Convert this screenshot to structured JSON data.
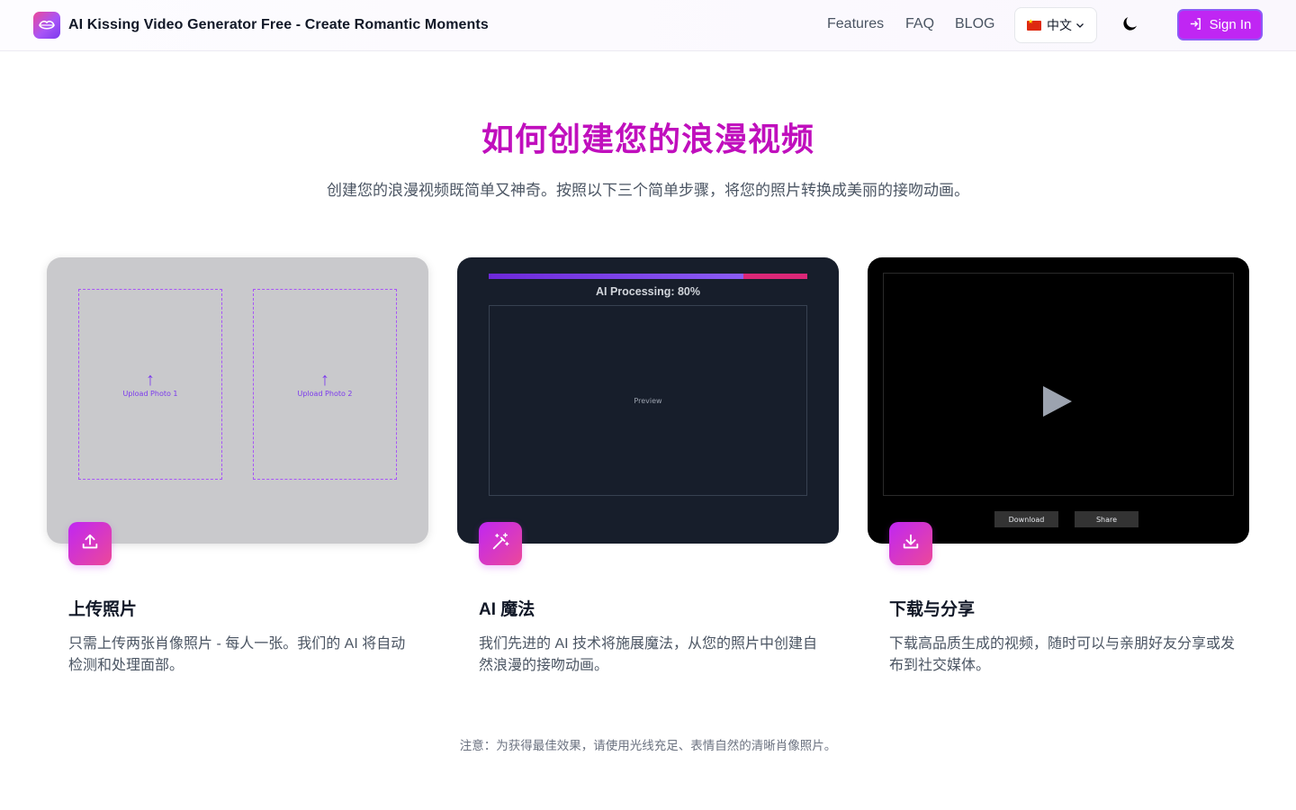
{
  "header": {
    "title": "AI Kissing Video Generator Free - Create Romantic Moments",
    "nav": [
      "Features",
      "FAQ",
      "BLOG"
    ],
    "language": "中文",
    "sign_in": "Sign In"
  },
  "hero": {
    "title": "如何创建您的浪漫视频",
    "subtitle": "创建您的浪漫视频既简单又神奇。按照以下三个简单步骤，将您的照片转换成美丽的接吻动画。"
  },
  "steps": [
    {
      "title": "上传照片",
      "description": "只需上传两张肖像照片 - 每人一张。我们的 AI 将自动检测和处理面部。",
      "media": {
        "upload_labels": [
          "Upload Photo 1",
          "Upload Photo 2"
        ]
      }
    },
    {
      "title": "AI 魔法",
      "description": "我们先进的 AI 技术将施展魔法，从您的照片中创建自然浪漫的接吻动画。",
      "media": {
        "progress_label": "AI Processing: 80%",
        "progress": 0.8,
        "preview_label": "Preview"
      }
    },
    {
      "title": "下载与分享",
      "description": "下载高品质生成的视频，随时可以与亲朋好友分享或发布到社交媒体。",
      "media": {
        "buttons": [
          "Download",
          "Share"
        ]
      }
    }
  ],
  "note": "注意：为获得最佳效果，请使用光线充足、表情自然的清晰肖像照片。",
  "colors": {
    "accent": "#c026f3",
    "title": "#c00fbd",
    "progress_fill": "#7c3aed",
    "progress_track": "#db2777"
  },
  "icons": {
    "logo": "lips-icon",
    "theme": "moon-icon",
    "sign_in": "sign-in-icon",
    "step1": "upload-icon",
    "step2": "magic-wand-icon",
    "step3": "download-icon"
  }
}
